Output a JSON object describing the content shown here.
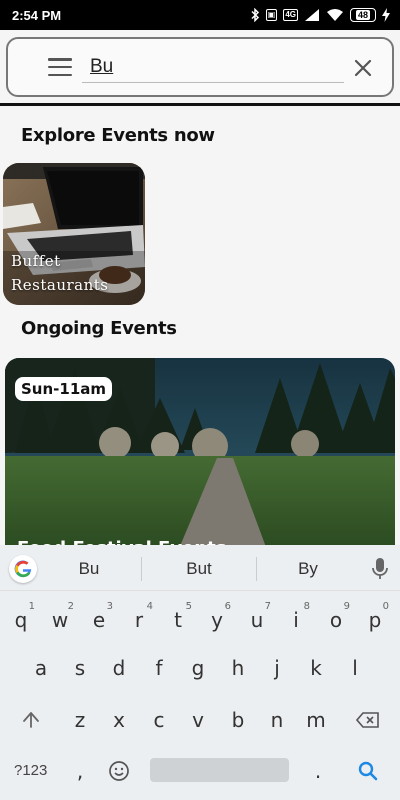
{
  "status_bar": {
    "time": "2:54 PM",
    "network_label": "4G",
    "battery": "48"
  },
  "search": {
    "value": "Bu"
  },
  "sections": {
    "explore_title": "Explore Events now",
    "ongoing_title": "Ongoing Events"
  },
  "categories": [
    {
      "line1": "Buffet",
      "line2": "Restaurants",
      "icon": "laptop-image"
    }
  ],
  "events": [
    {
      "badge": "Sun-11am",
      "title": "Food Festival Events"
    }
  ],
  "keyboard": {
    "suggestions": [
      "Bu",
      "But",
      "By"
    ],
    "row1": [
      {
        "k": "q",
        "n": "1"
      },
      {
        "k": "w",
        "n": "2"
      },
      {
        "k": "e",
        "n": "3"
      },
      {
        "k": "r",
        "n": "4"
      },
      {
        "k": "t",
        "n": "5"
      },
      {
        "k": "y",
        "n": "6"
      },
      {
        "k": "u",
        "n": "7"
      },
      {
        "k": "i",
        "n": "8"
      },
      {
        "k": "o",
        "n": "9"
      },
      {
        "k": "p",
        "n": "0"
      }
    ],
    "row2": [
      "a",
      "s",
      "d",
      "f",
      "g",
      "h",
      "j",
      "k",
      "l"
    ],
    "row3": [
      "z",
      "x",
      "c",
      "v",
      "b",
      "n",
      "m"
    ],
    "symbols_label": "?123",
    "comma": ",",
    "period": "."
  },
  "colors": {
    "accent_blue": "#1e88e5",
    "status_bg": "#000000"
  }
}
